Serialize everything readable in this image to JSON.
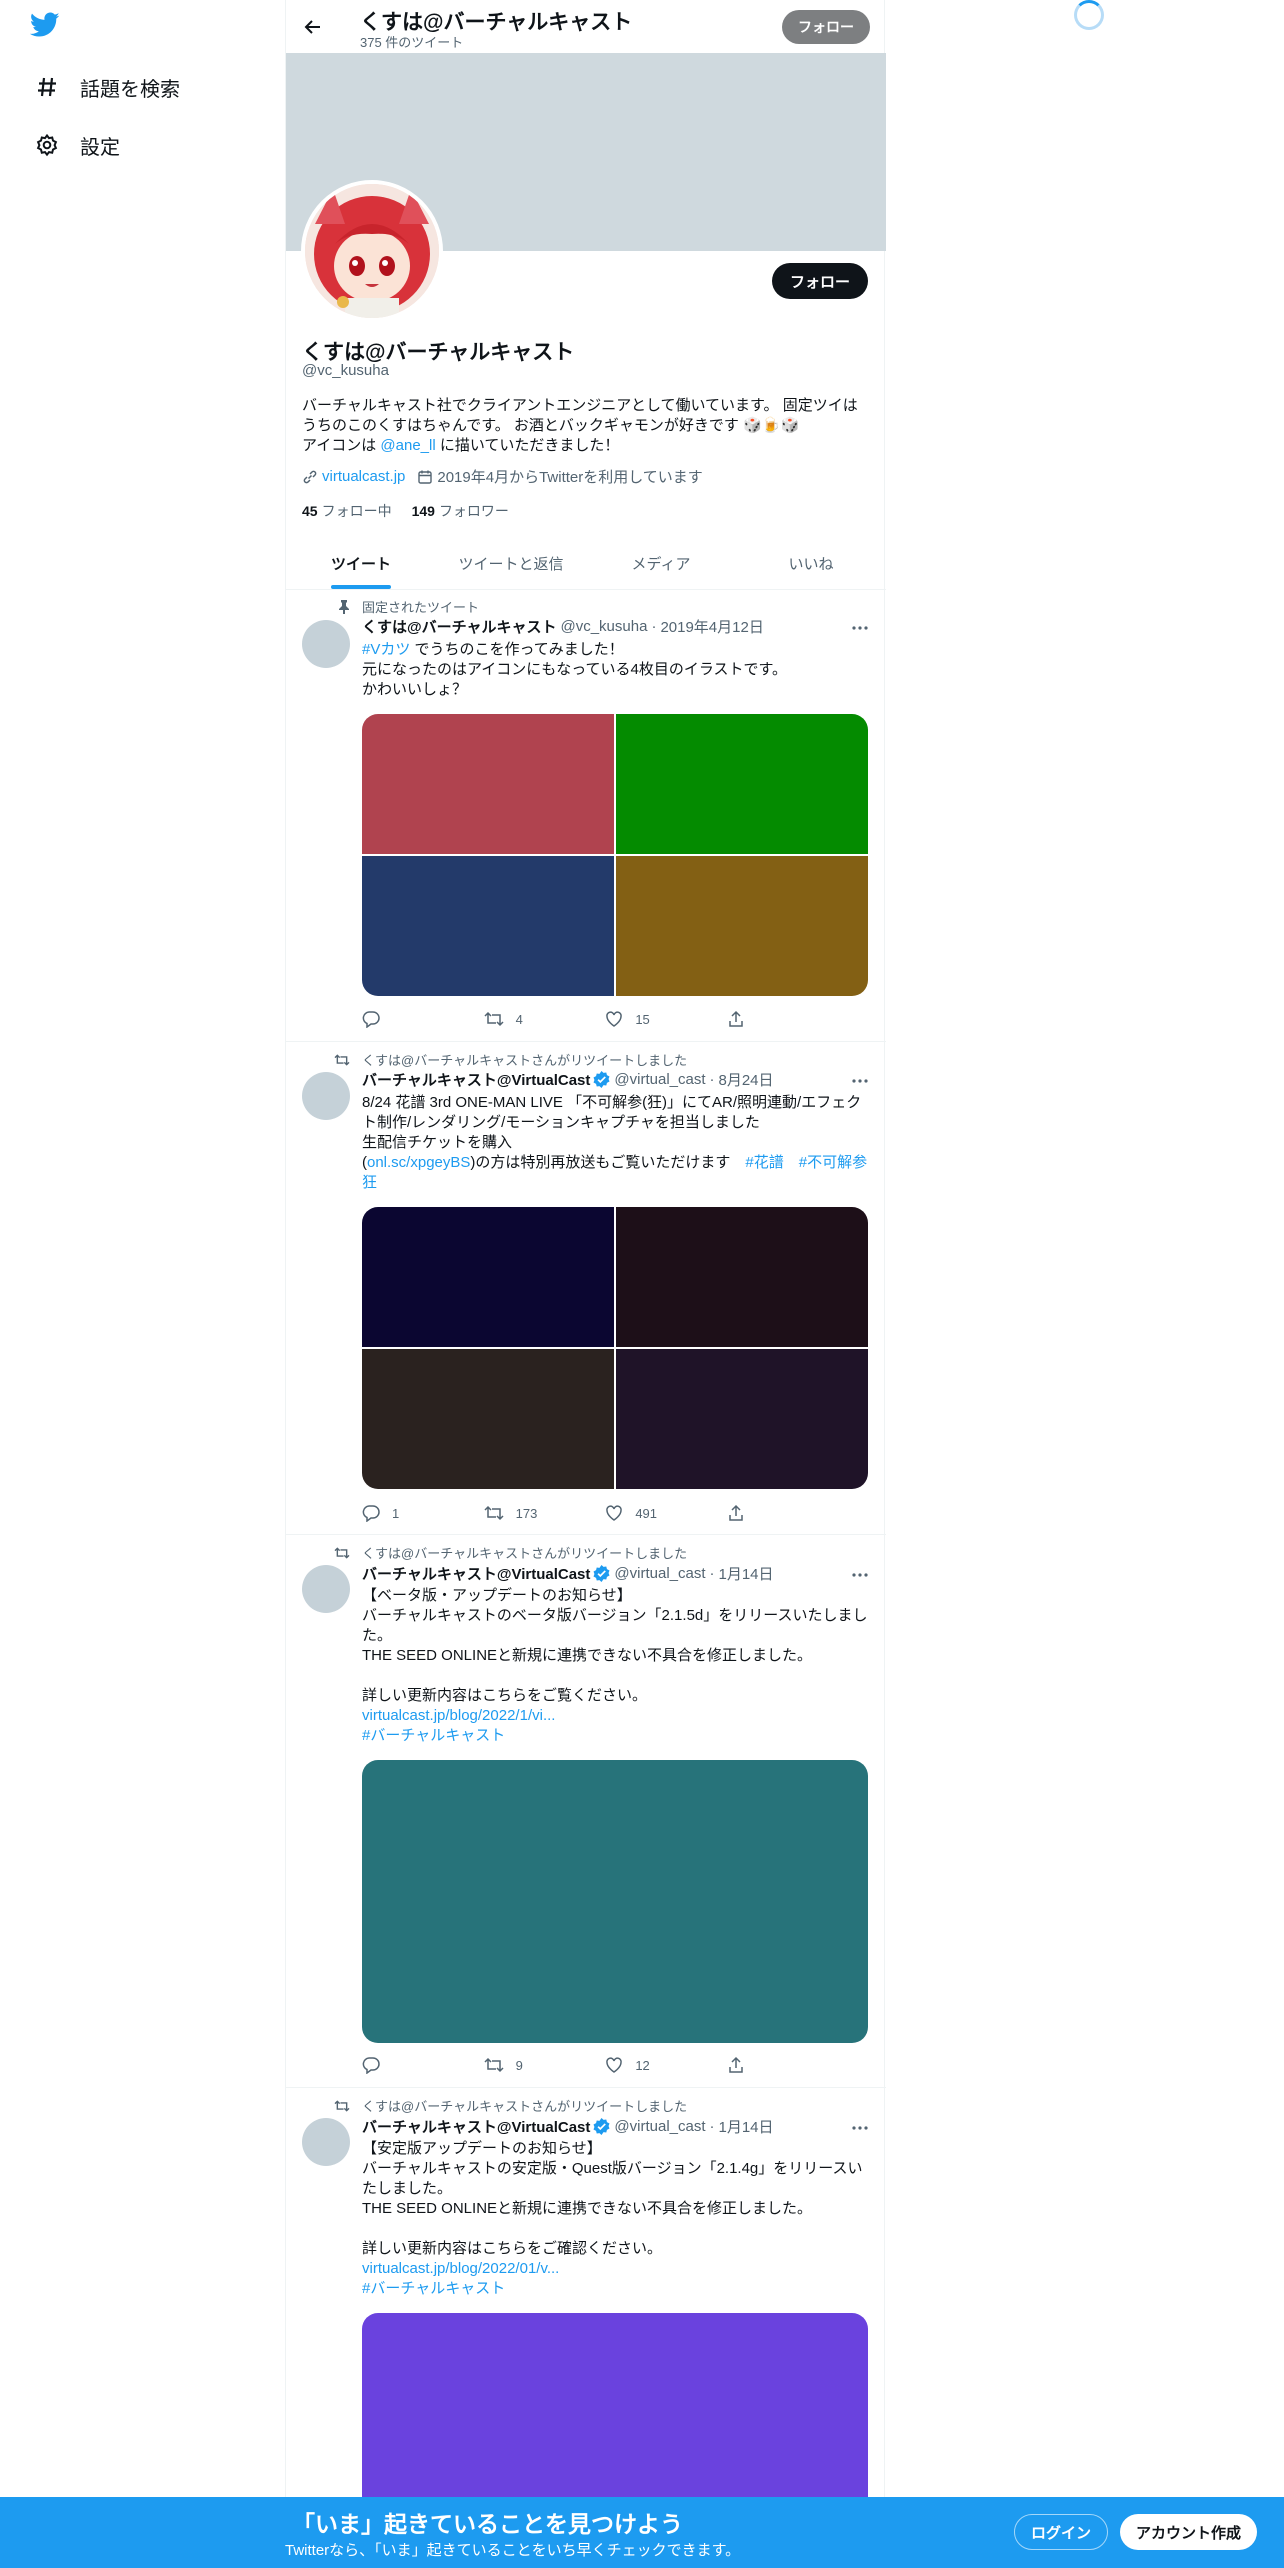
{
  "nav": {
    "items": [
      {
        "label": "話題を検索",
        "icon": "hashtag-icon"
      },
      {
        "label": "設定",
        "icon": "gear-icon"
      }
    ]
  },
  "header": {
    "title": "くすは@バーチャルキャスト",
    "subtitle": "375 件のツイート",
    "follow_label": "フォロー"
  },
  "profile": {
    "name": "くすは@バーチャルキャスト",
    "handle": "@vc_kusuha",
    "follow_label": "フォロー",
    "bio_line1": "バーチャルキャスト社でクライアントエンジニアとして働いています。 固定ツイはうちのこのくすはちゃんです。 お酒とバックギャモンが好きです",
    "bio_line2_prefix": "アイコンは ",
    "bio_mention": "@ane_ll",
    "bio_line2_suffix": " に描いていただきました！",
    "website": "virtualcast.jp",
    "joined": "2019年4月からTwitterを利用しています",
    "following_count": "45",
    "following_label": "フォロー中",
    "followers_count": "149",
    "followers_label": "フォロワー"
  },
  "tabs": [
    {
      "label": "ツイート",
      "active": true
    },
    {
      "label": "ツイートと返信",
      "active": false
    },
    {
      "label": "メディア",
      "active": false
    },
    {
      "label": "いいね",
      "active": false
    }
  ],
  "tweets": [
    {
      "context": "固定されたツイート",
      "name": "くすは@バーチャルキャスト",
      "handle": "@vc_kusuha",
      "date": "2019年4月12日",
      "hashtag": "#Vカツ",
      "text_rest": " でうちのこを作ってみました！\n元になったのはアイコンにもなっている4枚目のイラストです。\nかわいいしょ？",
      "media_colors": [
        "#b0434f",
        "#048b00",
        "#233a6a",
        "#836014"
      ],
      "reply_count": "",
      "retweet_count": "4",
      "like_count": "15"
    },
    {
      "context": "くすは@バーチャルキャストさんがリツイートしました",
      "name": "バーチャルキャスト@VirtualCast",
      "handle": "@virtual_cast",
      "date": "8月24日",
      "text_main": "8/24 花譜 3rd ONE-MAN LIVE 「不可解参(狂)」にてAR/照明連動/エフェクト制作/レンダリング/モーションキャプチャを担当しました\n生配信チケットを購入\n(",
      "link": "onl.sc/xpgeyBS",
      "text_after_link": ")の方は特別再放送もご覧いただけます　",
      "hashtag1": "#花譜",
      "hashtag2": "#不可解参狂",
      "media_colors": [
        "#0b0631",
        "#1d0f18",
        "#2a221f",
        "#1f1328"
      ],
      "reply_count": "1",
      "retweet_count": "173",
      "like_count": "491"
    },
    {
      "context": "くすは@バーチャルキャストさんがリツイートしました",
      "name": "バーチャルキャスト@VirtualCast",
      "handle": "@virtual_cast",
      "date": "1月14日",
      "text": "【ベータ版・アップデートのお知らせ】\nバーチャルキャストのベータ版バージョン「2.1.5d」をリリースいたしました。\nTHE SEED ONLINEと新規に連携できない不具合を修正しました。\n\n詳しい更新内容はこちらをご覧ください。",
      "link": "virtualcast.jp/blog/2022/1/vi...",
      "hashtag": "#バーチャルキャスト",
      "media_color": "#27737a",
      "reply_count": "",
      "retweet_count": "9",
      "like_count": "12"
    },
    {
      "context": "くすは@バーチャルキャストさんがリツイートしました",
      "name": "バーチャルキャスト@VirtualCast",
      "handle": "@virtual_cast",
      "date": "1月14日",
      "text": "【安定版アップデートのお知らせ】\nバーチャルキャストの安定版・Quest版バージョン「2.1.4g」をリリースいたしました。\nTHE SEED ONLINEと新規に連携できない不具合を修正しました。\n\n詳しい更新内容はこちらをご確認ください。",
      "link": "virtualcast.jp/blog/2022/01/v...",
      "hashtag": "#バーチャルキャスト",
      "media_color": "#6a42de"
    }
  ],
  "bottom_banner": {
    "title": "「いま」起きていることを見つけよう",
    "subtitle": "Twitterなら、「いま」起きていることをいち早くチェックできます。",
    "login_label": "ログイン",
    "signup_label": "アカウント作成"
  },
  "colors": {
    "accent": "#1d9bf0",
    "text": "#0f1419",
    "muted": "#536471",
    "banner": "#cfd9de"
  }
}
